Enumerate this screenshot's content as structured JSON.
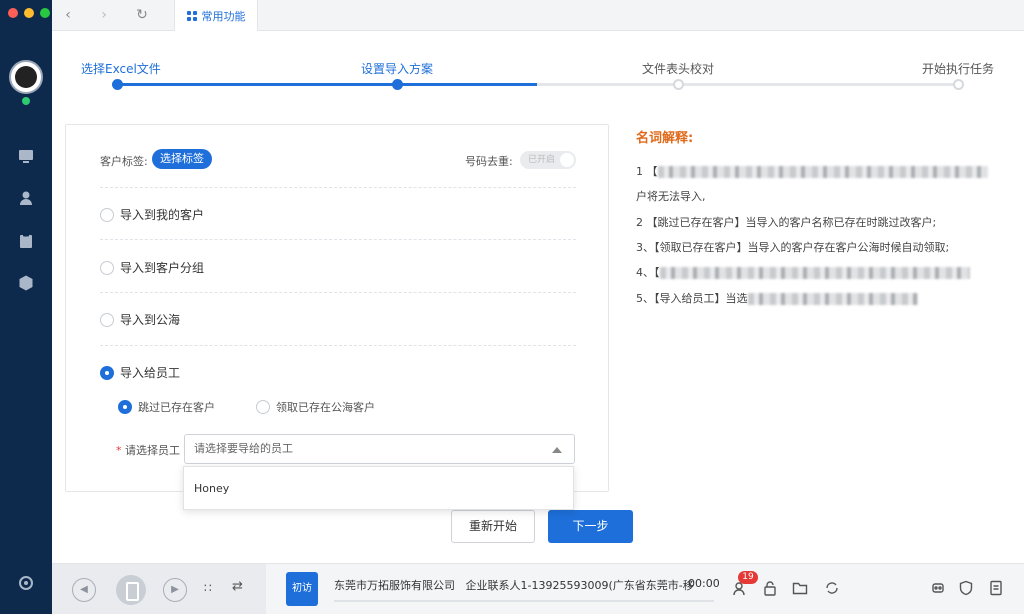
{
  "window": {
    "traffic_colors": [
      "#ff5f57",
      "#febc2e",
      "#28c840"
    ]
  },
  "topbar": {
    "back_icon": "chevron-left-icon",
    "forward_icon": "chevron-right-icon",
    "refresh_icon": "refresh-icon",
    "tab_label": "常用功能"
  },
  "steps": [
    {
      "label": "选择Excel文件",
      "state": "done"
    },
    {
      "label": "设置导入方案",
      "state": "active"
    },
    {
      "label": "文件表头校对",
      "state": "todo"
    },
    {
      "label": "开始执行任务",
      "state": "todo"
    }
  ],
  "colors": {
    "primary": "#1e6fd9",
    "accent_orange": "#e06a1b",
    "rail_bg": "#0d2a4d"
  },
  "form": {
    "customer_tag_label": "客户标签:",
    "select_tag_button": "选择标签",
    "dedupe_label": "号码去重:",
    "dedupe_toggle_text": "已开启",
    "options": [
      {
        "label": "导入到我的客户",
        "selected": false
      },
      {
        "label": "导入到客户分组",
        "selected": false
      },
      {
        "label": "导入到公海",
        "selected": false
      },
      {
        "label": "导入给员工",
        "selected": true
      }
    ],
    "sub_options": [
      {
        "label": "跳过已存在客户",
        "selected": true
      },
      {
        "label": "领取已存在公海客户",
        "selected": false
      }
    ],
    "employee_required_mark": "*",
    "employee_label": "请选择员工",
    "employee_placeholder": "请选择要导给的员工",
    "dropdown_option": "Honey"
  },
  "explain": {
    "title": "名词解释:",
    "lines": [
      "1 【",
      "户将无法导入,",
      "2 【跳过已存在客户】当导入的客户名称已存在时跳过改客户;",
      "3、【领取已存在客户】当导入的客户存在客户公海时候自动领取;",
      "4、【",
      "5、【导入给员工】当选"
    ]
  },
  "actions": {
    "restart": "重新开始",
    "next": "下一步"
  },
  "callbar": {
    "status_tag": "初访",
    "company": "东莞市万拓服饰有限公司",
    "contact": "企业联系人1-13925593009(广东省东莞市-移",
    "timer": "00:00",
    "badge_count": "19"
  }
}
